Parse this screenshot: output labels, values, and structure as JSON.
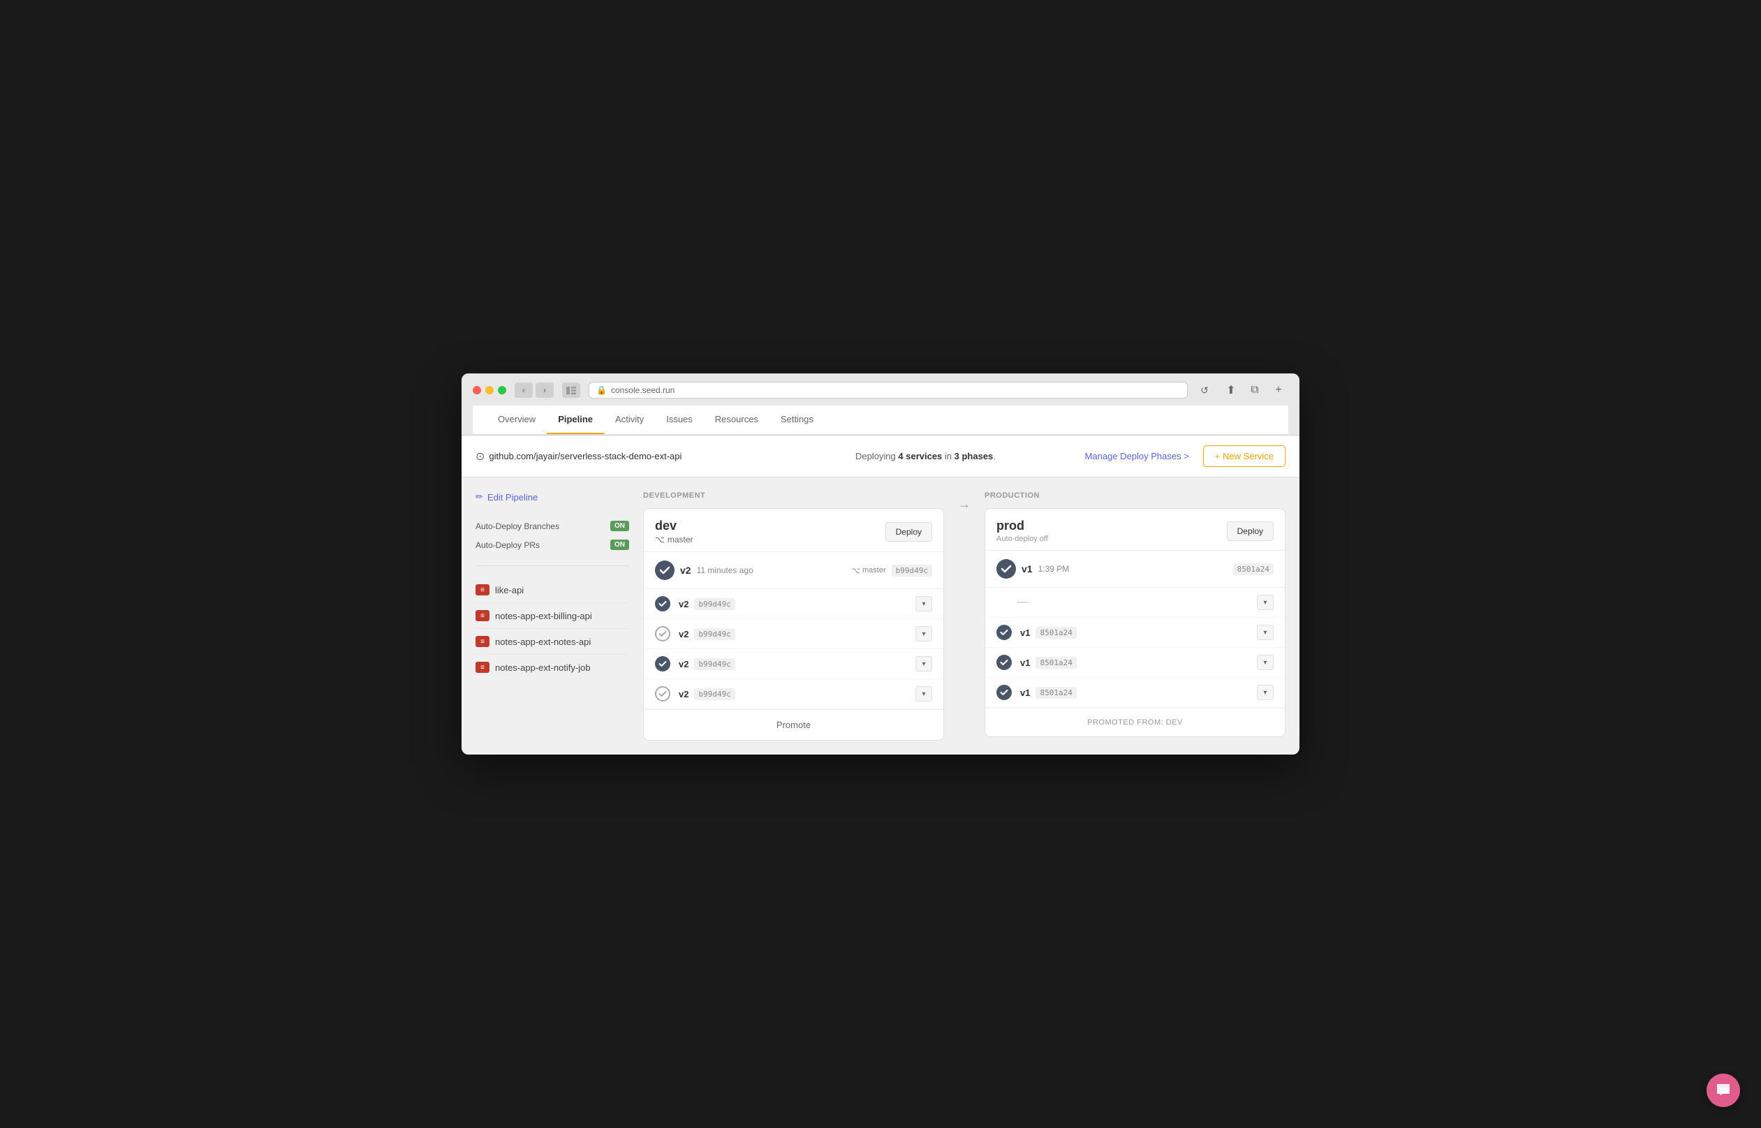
{
  "browser": {
    "url": "console.seed.run",
    "lock_icon": "🔒"
  },
  "nav": {
    "tabs": [
      {
        "label": "Overview",
        "active": false
      },
      {
        "label": "Pipeline",
        "active": true
      },
      {
        "label": "Activity",
        "active": false
      },
      {
        "label": "Issues",
        "active": false
      },
      {
        "label": "Resources",
        "active": false
      },
      {
        "label": "Settings",
        "active": false
      }
    ]
  },
  "infobar": {
    "repo_url": "github.com/jayair/serverless-stack-demo-ext-api",
    "deploy_text_prefix": "Deploying ",
    "deploy_count": "4 services",
    "deploy_text_middle": " in ",
    "deploy_phases": "3 phases",
    "deploy_text_suffix": ".",
    "manage_phases": "Manage Deploy Phases >",
    "new_service_label": "+ New Service"
  },
  "sidebar": {
    "edit_pipeline_label": "Edit Pipeline",
    "settings": [
      {
        "label": "Auto-Deploy Branches",
        "value": "ON"
      },
      {
        "label": "Auto-Deploy PRs",
        "value": "ON"
      }
    ],
    "services": [
      {
        "name": "like-api"
      },
      {
        "name": "notes-app-ext-billing-api"
      },
      {
        "name": "notes-app-ext-notes-api"
      },
      {
        "name": "notes-app-ext-notify-job"
      }
    ]
  },
  "development": {
    "stage_label": "DEVELOPMENT",
    "env": {
      "name": "dev",
      "branch": "master",
      "deploy_label": "Deploy",
      "commit": {
        "version": "v2",
        "time": "11 minutes ago",
        "branch": "master",
        "hash": "b99d49c"
      },
      "services": [
        {
          "version": "v2",
          "hash": "b99d49c",
          "icon_type": "filled"
        },
        {
          "version": "v2",
          "hash": "b99d49c",
          "icon_type": "outline"
        },
        {
          "version": "v2",
          "hash": "b99d49c",
          "icon_type": "filled"
        },
        {
          "version": "v2",
          "hash": "b99d49c",
          "icon_type": "outline"
        }
      ],
      "promote_label": "Promote"
    }
  },
  "production": {
    "stage_label": "PRODUCTION",
    "env": {
      "name": "prod",
      "auto_deploy": "Auto-deploy off",
      "deploy_label": "Deploy",
      "commit": {
        "version": "v1",
        "time": "1:39 PM",
        "hash": "8501a24"
      },
      "services": [
        {
          "version": null,
          "hash": null,
          "icon_type": "dash"
        },
        {
          "version": "v1",
          "hash": "8501a24",
          "icon_type": "filled"
        },
        {
          "version": "v1",
          "hash": "8501a24",
          "icon_type": "filled"
        },
        {
          "version": "v1",
          "hash": "8501a24",
          "icon_type": "filled"
        }
      ],
      "promoted_from": "PROMOTED FROM: dev"
    }
  }
}
